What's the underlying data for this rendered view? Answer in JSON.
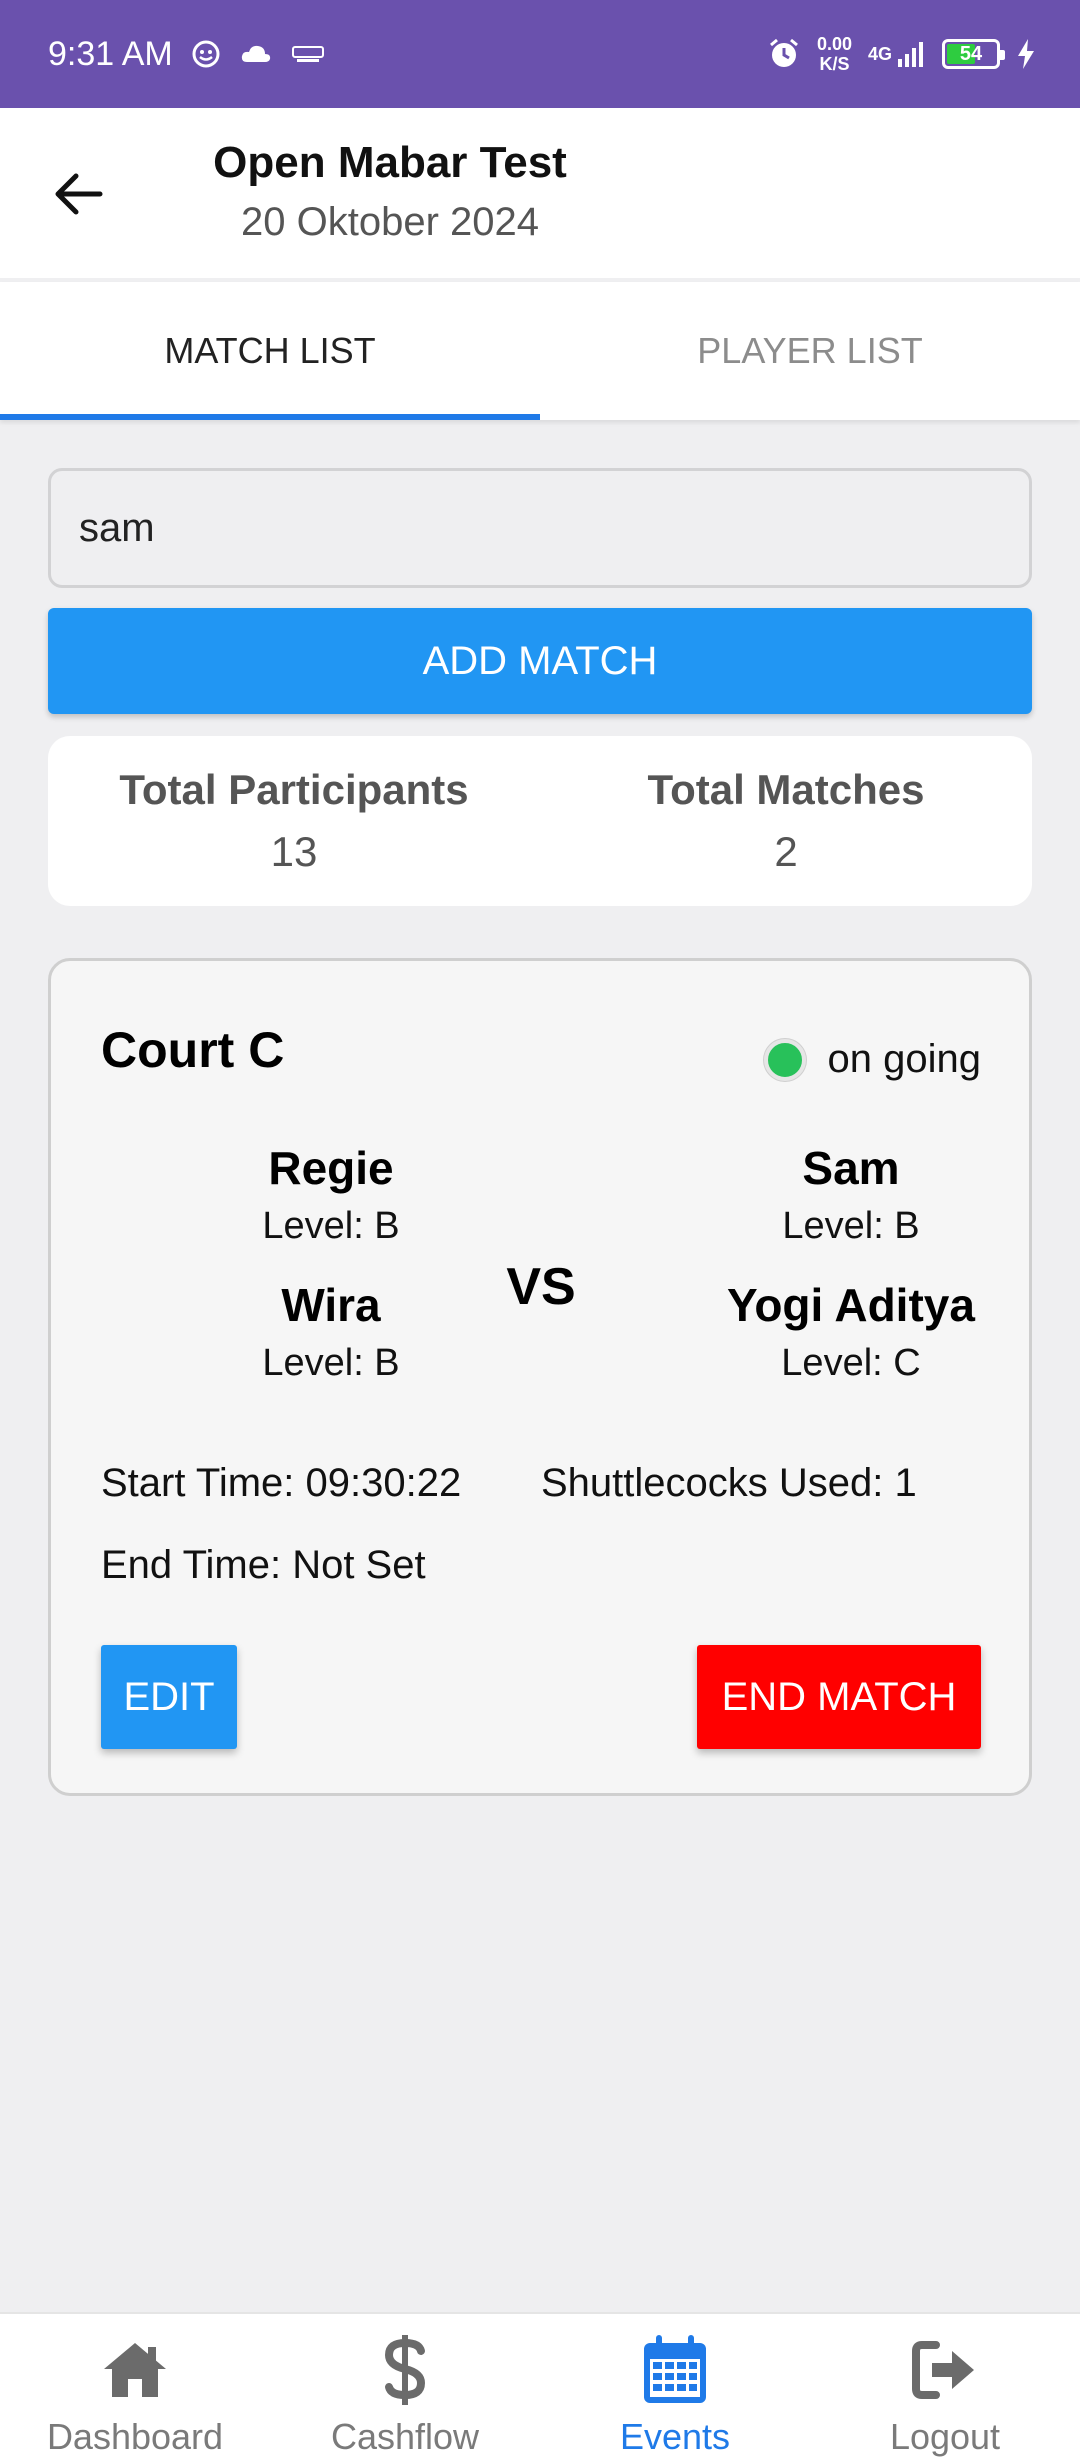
{
  "status_bar": {
    "time": "9:31 AM",
    "net_speed_value": "0.00",
    "net_speed_unit": "K/S",
    "network": "4G",
    "battery": "54"
  },
  "header": {
    "title": "Open Mabar Test",
    "date": "20 Oktober 2024"
  },
  "tabs": [
    {
      "label": "MATCH LIST",
      "active": true
    },
    {
      "label": "PLAYER LIST",
      "active": false
    }
  ],
  "search": {
    "value": "sam"
  },
  "add_match_label": "ADD MATCH",
  "stats": {
    "participants_label": "Total Participants",
    "participants_value": "13",
    "matches_label": "Total Matches",
    "matches_value": "2"
  },
  "match": {
    "court": "Court C",
    "status": "on going",
    "status_color": "#28c15a",
    "vs": "VS",
    "team_left": [
      {
        "name": "Regie",
        "level": "Level: B"
      },
      {
        "name": "Wira",
        "level": "Level: B"
      }
    ],
    "team_right": [
      {
        "name": "Sam",
        "level": "Level: B"
      },
      {
        "name": "Yogi Aditya",
        "level": "Level: C"
      }
    ],
    "start_time": "Start Time: 09:30:22",
    "shuttlecocks": "Shuttlecocks Used: 1",
    "end_time": "End Time: Not Set",
    "edit_label": "EDIT",
    "end_label": "END MATCH"
  },
  "bottom_nav": [
    {
      "label": "Dashboard",
      "icon": "home-icon",
      "active": false
    },
    {
      "label": "Cashflow",
      "icon": "dollar-icon",
      "active": false
    },
    {
      "label": "Events",
      "icon": "calendar-icon",
      "active": true
    },
    {
      "label": "Logout",
      "icon": "logout-icon",
      "active": false
    }
  ],
  "colors": {
    "status_bar": "#6a51ad",
    "primary": "#2196f3",
    "danger": "#ff0000",
    "tab_indicator": "#1f7ae8"
  }
}
